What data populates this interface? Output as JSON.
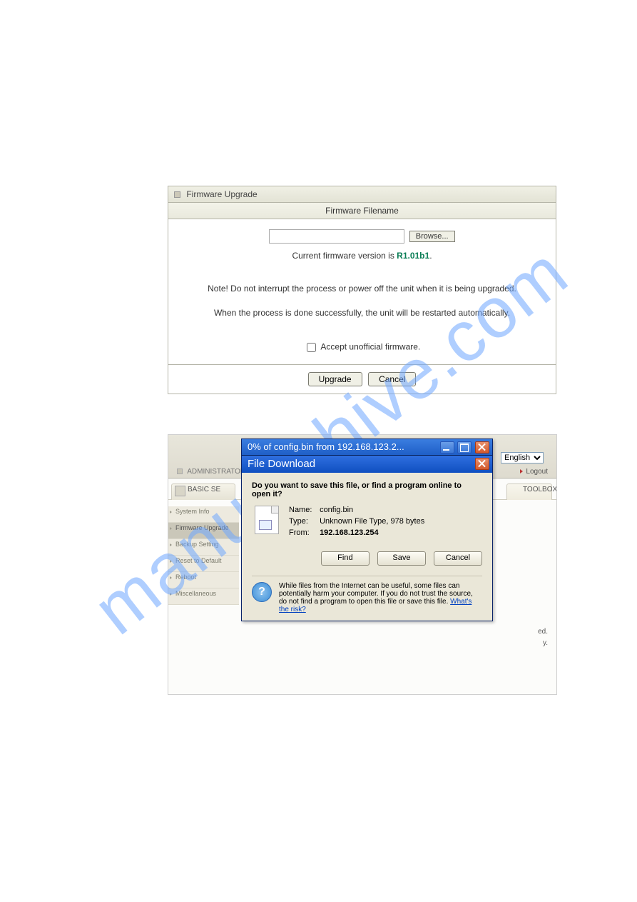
{
  "watermark_text": "manualshive.com",
  "panel1": {
    "header": "Firmware Upgrade",
    "subheader": "Firmware Filename",
    "browse_label": "Browse...",
    "version_prefix": "Current firmware version is ",
    "version_value": "R1.01b1",
    "version_suffix": ".",
    "note_line1": "Note! Do not interrupt the process or power off the unit when it is being upgraded.",
    "note_line2": "When the process is done successfully, the unit will be restarted automatically.",
    "accept_label": "Accept unofficial firmware.",
    "btn_upgrade": "Upgrade",
    "btn_cancel": "Cancel",
    "filename_value": ""
  },
  "panel2": {
    "admin_title_prefix": "ADMINISTRATOR's I",
    "lang_selected": "English",
    "logout_label": "Logout",
    "tab_basic": "BASIC SE",
    "tab_toolbox": "TOOLBOX",
    "sidebar": [
      "System Info",
      "Firmware Upgrade",
      "Backup Setting",
      "Reset to Default",
      "Reboot",
      "Miscellaneous"
    ],
    "sidebar_active_index": 1,
    "truncated_right_1": "",
    "truncated_right_2": "ed.",
    "truncated_right_3": "y."
  },
  "xp_dialog": {
    "title1": "0% of config.bin from 192.168.123.2...",
    "title2": "File Download",
    "prompt": "Do you want to save this file, or find a program online to open it?",
    "label_name": "Name:",
    "label_type": "Type:",
    "label_from": "From:",
    "value_name": "config.bin",
    "value_type": "Unknown File Type, 978 bytes",
    "value_from": "192.168.123.254",
    "btn_find": "Find",
    "btn_save": "Save",
    "btn_cancel": "Cancel",
    "warning_text_1": "While files from the Internet can be useful, some files can potentially harm your computer. If you do not trust the source, do not find a program to open this file or save this file. ",
    "warning_link": "What's the risk?",
    "info_glyph": "?"
  }
}
